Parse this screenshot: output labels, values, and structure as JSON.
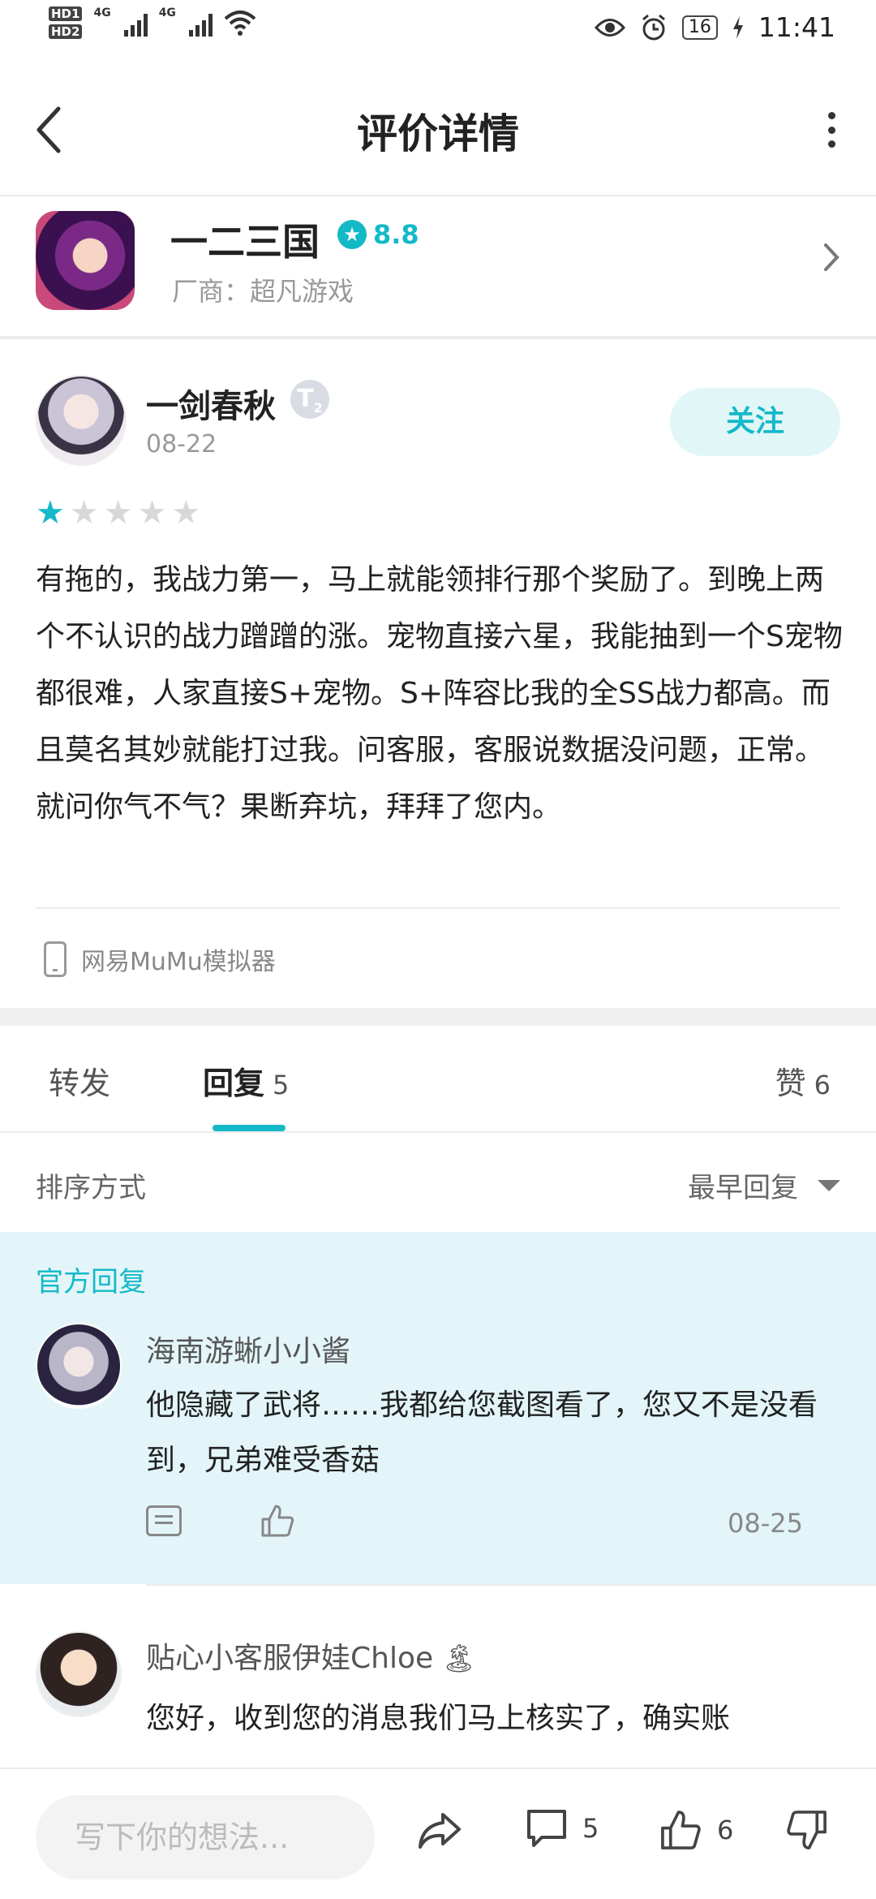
{
  "status_bar": {
    "hd1": "HD1",
    "hd2": "HD2",
    "sig1": "4G",
    "sig2": "4G",
    "battery": "16",
    "time": "11:41",
    "icons": [
      "eye-icon",
      "alarm-icon",
      "wifi-icon",
      "charging-icon"
    ]
  },
  "header": {
    "title": "评价详情"
  },
  "game": {
    "name": "一二三国",
    "rating": "8.8",
    "vendor_label": "厂商：",
    "vendor": "超凡游戏"
  },
  "review": {
    "author": "一剑春秋",
    "level": "T",
    "level_sub": "2",
    "date": "08-22",
    "follow_label": "关注",
    "stars_filled": 1,
    "stars_total": 5,
    "text": "有拖的，我战力第一，马上就能领排行那个奖励了。到晚上两个不认识的战力蹭蹭的涨。宠物直接六星，我能抽到一个S宠物都很难，人家直接S+宠物。S+阵容比我的全SS战力都高。而且莫名其妙就能打过我。问客服，客服说数据没问题，正常。就问你气不气？果断弃坑，拜拜了您内。",
    "device": "网易MuMu模拟器"
  },
  "tabs": {
    "forward": "转发",
    "reply": "回复",
    "reply_count": "5",
    "like": "赞",
    "like_count": "6"
  },
  "sort": {
    "label": "排序方式",
    "value": "最早回复"
  },
  "official_reply": {
    "label": "官方回复",
    "name": "海南游蜥小小酱",
    "text": "他隐藏了武将……我都给您截图看了，您又不是没看到，兄弟难受香菇",
    "date": "08-25"
  },
  "reply2": {
    "name": "贴心小客服伊娃Chloe",
    "emoji": "🏝",
    "text": "您好，收到您的消息我们马上核实了，确实账"
  },
  "bottom_bar": {
    "placeholder": "写下你的想法...",
    "comment_count": "5",
    "like_count": "6"
  },
  "colors": {
    "accent": "#14b9c8",
    "official_bg": "#e3f5f8",
    "follow_bg": "#e1f6f7"
  }
}
